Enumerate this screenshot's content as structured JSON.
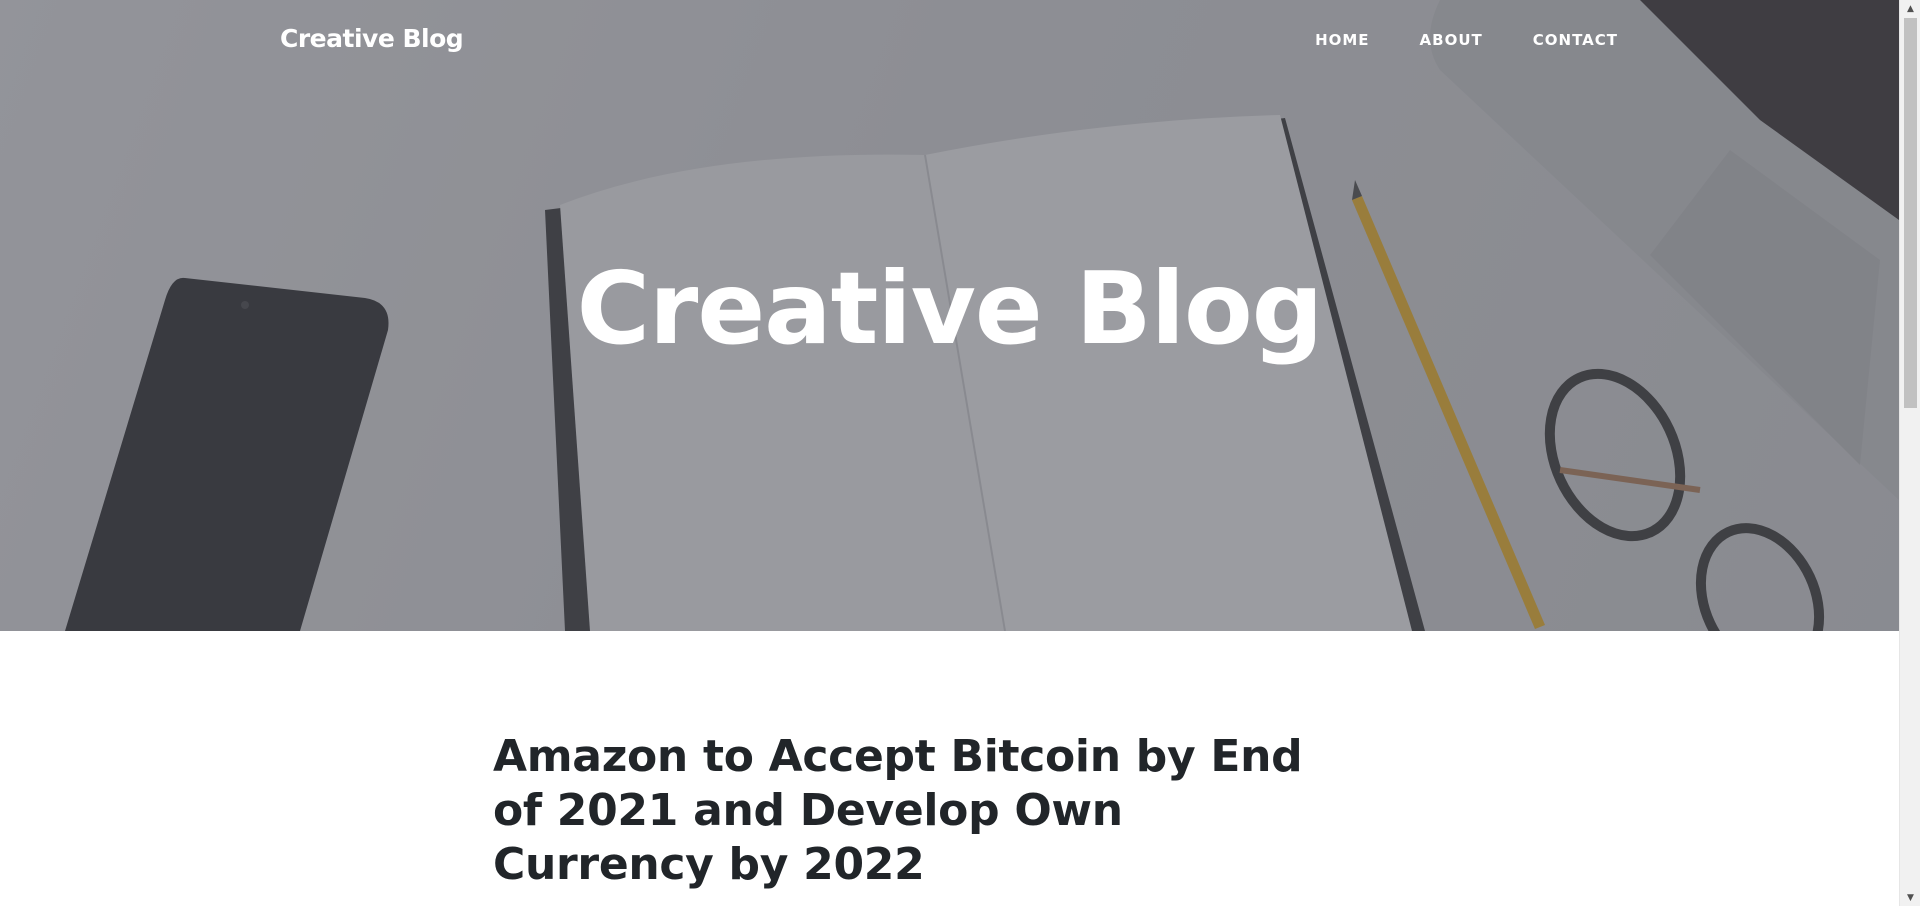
{
  "navbar": {
    "brand": "Creative Blog",
    "links": [
      "HOME",
      "ABOUT",
      "CONTACT"
    ]
  },
  "hero": {
    "title": "Creative Blog"
  },
  "post": {
    "title": "Amazon to Accept Bitcoin by End of 2021 and Develop Own Currency by 2022"
  },
  "scrollbar": {
    "up_icon": "arrow-up-icon",
    "down_icon": "arrow-down-icon"
  },
  "colors": {
    "heading_text": "#212529",
    "overlay": "#50525a",
    "nav_text": "#ffffff"
  }
}
